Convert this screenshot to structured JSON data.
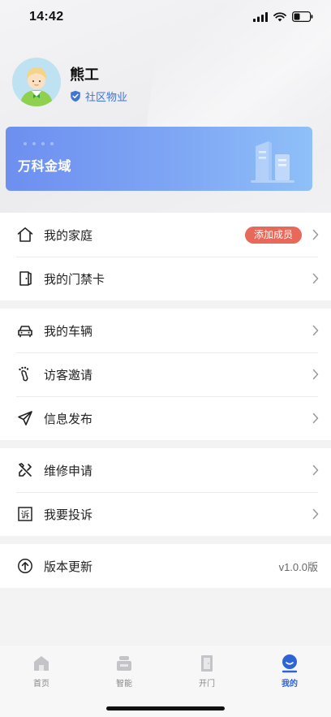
{
  "status_bar": {
    "time": "14:42"
  },
  "profile": {
    "name": "熊工",
    "role": "社区物业"
  },
  "community": {
    "name": "万科金域"
  },
  "menu_groups": [
    {
      "items": [
        {
          "label": "我的家庭",
          "icon": "home-icon",
          "badge": "添加成员"
        },
        {
          "label": "我的门禁卡",
          "icon": "door-icon"
        }
      ]
    },
    {
      "items": [
        {
          "label": "我的车辆",
          "icon": "car-icon"
        },
        {
          "label": "访客邀请",
          "icon": "footprint-icon"
        },
        {
          "label": "信息发布",
          "icon": "send-icon"
        }
      ]
    },
    {
      "items": [
        {
          "label": "维修申请",
          "icon": "tools-icon"
        },
        {
          "label": "我要投诉",
          "icon": "complaint-icon",
          "icon_text": "诉"
        }
      ]
    },
    {
      "items": [
        {
          "label": "版本更新",
          "icon": "upload-icon",
          "value": "v1.0.0版"
        }
      ]
    }
  ],
  "tabbar": {
    "tabs": [
      {
        "label": "首页",
        "icon": "home-tab-icon"
      },
      {
        "label": "智能",
        "icon": "robot-icon"
      },
      {
        "label": "开门",
        "icon": "door-open-icon"
      },
      {
        "label": "我的",
        "icon": "profile-face-icon",
        "active": true
      }
    ]
  },
  "colors": {
    "accent": "#2e63d6",
    "badge": "#e8685a",
    "card_start": "#6d8ff0",
    "card_end": "#8fc0f8"
  }
}
